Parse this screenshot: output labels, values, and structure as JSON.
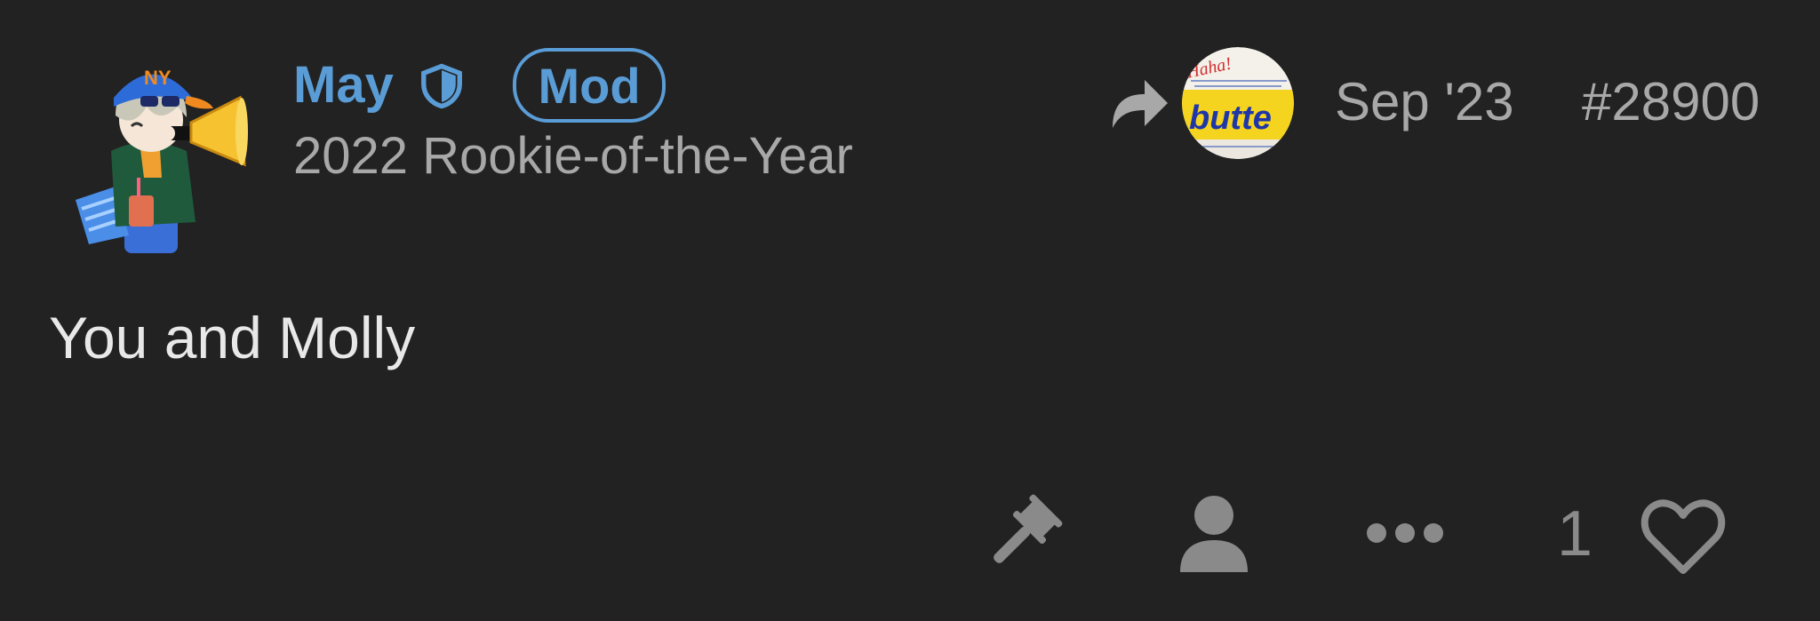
{
  "post": {
    "username": "May",
    "mod_badge": "Mod",
    "user_title": "2022 Rookie-of-the-Year",
    "date": "Sep '23",
    "post_number": "#28900",
    "body": "You and Molly",
    "like_count": "1"
  },
  "reply_avatar": {
    "caption_top": "Haha!",
    "caption_main": "butte"
  },
  "icons": {
    "moderator": "shield-icon",
    "reply": "reply-arrow-icon",
    "admin": "gavel-icon",
    "profile": "user-icon",
    "more": "ellipsis-icon",
    "like": "heart-icon"
  },
  "colors": {
    "background": "#222222",
    "accent": "#5a9cd6",
    "muted_text": "#a8a8a8",
    "body_text": "#e8e8e8",
    "icon_gray": "#8a8a8a"
  }
}
